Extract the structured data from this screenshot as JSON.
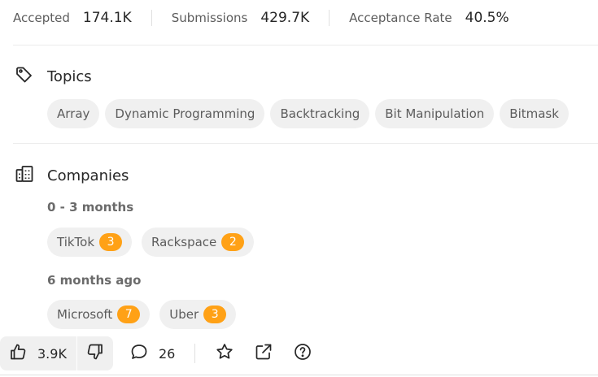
{
  "stats": {
    "accepted_label": "Accepted",
    "accepted_value": "174.1K",
    "submissions_label": "Submissions",
    "submissions_value": "429.7K",
    "rate_label": "Acceptance Rate",
    "rate_value": "40.5%"
  },
  "topics": {
    "title": "Topics",
    "icon": "tag-icon",
    "items": [
      "Array",
      "Dynamic Programming",
      "Backtracking",
      "Bit Manipulation",
      "Bitmask"
    ]
  },
  "companies": {
    "title": "Companies",
    "icon": "building-icon",
    "groups": [
      {
        "period": "0 - 3 months",
        "items": [
          {
            "name": "TikTok",
            "count": "3"
          },
          {
            "name": "Rackspace",
            "count": "2"
          }
        ]
      },
      {
        "period": "6 months ago",
        "items": [
          {
            "name": "Microsoft",
            "count": "7"
          },
          {
            "name": "Uber",
            "count": "3"
          }
        ]
      }
    ]
  },
  "toolbar": {
    "likes": "3.9K",
    "comments": "26",
    "icons": [
      "thumbs-up-icon",
      "thumbs-down-icon",
      "comment-icon",
      "star-icon",
      "share-icon",
      "help-icon"
    ]
  },
  "colors": {
    "badge": "#ffa116",
    "chip_bg": "#f0f0f0"
  }
}
